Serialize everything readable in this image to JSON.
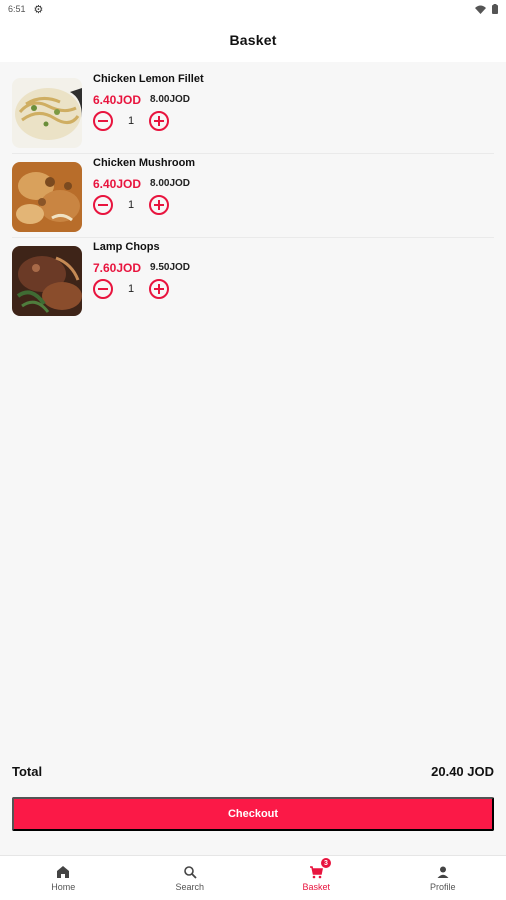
{
  "status_bar": {
    "time": "6:51"
  },
  "app_bar": {
    "title": "Basket"
  },
  "basket": {
    "items": [
      {
        "name": "Chicken Lemon Fillet",
        "price": "6.40JOD",
        "old_price": "8.00JOD",
        "quantity": "1",
        "image": "pasta-dish"
      },
      {
        "name": "Chicken Mushroom",
        "price": "6.40JOD",
        "old_price": "8.00JOD",
        "quantity": "1",
        "image": "chicken-mushroom-dish"
      },
      {
        "name": "Lamp Chops",
        "price": "7.60JOD",
        "old_price": "9.50JOD",
        "quantity": "1",
        "image": "lamb-chops-dish"
      }
    ]
  },
  "summary": {
    "total_label": "Total",
    "total_value": "20.40 JOD"
  },
  "checkout": {
    "label": "Checkout"
  },
  "bottom_nav": {
    "items": [
      {
        "label": "Home",
        "icon": "home-icon"
      },
      {
        "label": "Search",
        "icon": "search-icon"
      },
      {
        "label": "Basket",
        "icon": "cart-icon",
        "badge": "3"
      },
      {
        "label": "Profile",
        "icon": "person-icon"
      }
    ]
  },
  "colors": {
    "accent": "#e8143e",
    "button": "#fb1947"
  }
}
